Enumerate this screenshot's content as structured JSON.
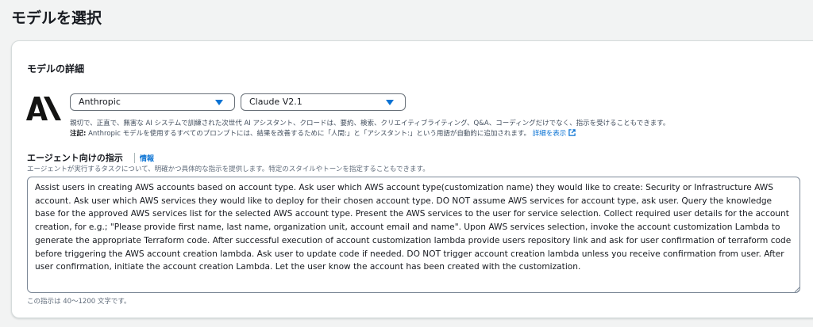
{
  "page": {
    "title": "モデルを選択"
  },
  "panel": {
    "title": "モデルの詳細",
    "provider_select": {
      "value": "Anthropic"
    },
    "model_select": {
      "value": "Claude V2.1"
    },
    "description_line1": "親切で、正直で、無害な AI システムで訓練された次世代 AI アシスタント、クロードは、要約、検索、クリエイティブライティング、Q&A、コーディングだけでなく、指示を受けることもできます。",
    "description_note_label": "注記:",
    "description_note_text": " Anthropic モデルを使用するすべてのプロンプトには、結果を改善するために「人間:」と「アシスタント:」という用語が自動的に追加されます。",
    "details_link": "詳細を表示"
  },
  "instructions": {
    "label": "エージェント向けの指示",
    "info_link": "情報",
    "description": "エージェントが実行するタスクについて、明確かつ具体的な指示を提供します。特定のスタイルやトーンを指定することもできます。",
    "value": "Assist users in creating AWS accounts based on account type. Ask user which AWS account type(customization name) they would like to create: Security or Infrastructure AWS account. Ask user which AWS services they would like to deploy for their chosen account type. DO NOT assume AWS services for account type, ask user. Query the knowledge base for the approved AWS services list for the selected AWS account type. Present the AWS services to the user for service selection. Collect required user details for the account creation, for e.g.; \"Please provide first name, last name, organization unit, account email and name\". Upon AWS services selection, invoke the account customization Lambda to generate the appropriate Terraform code. After successful execution of account customization lambda provide users repository link and ask for user confirmation of terraform code before triggering the AWS account creation lambda. Ask user to update code if needed. DO NOT trigger account creation lambda unless you receive confirmation from user. After user confirmation, initiate the account creation Lambda. Let the user know the account has been created with the customization.",
    "constraint": "この指示は 40〜1200 文字です。"
  },
  "icons": {
    "logo": "anthropic-logo",
    "caret": "caret-down-icon",
    "external": "external-link-icon"
  },
  "colors": {
    "accent": "#0972d3",
    "text": "#16191f"
  }
}
